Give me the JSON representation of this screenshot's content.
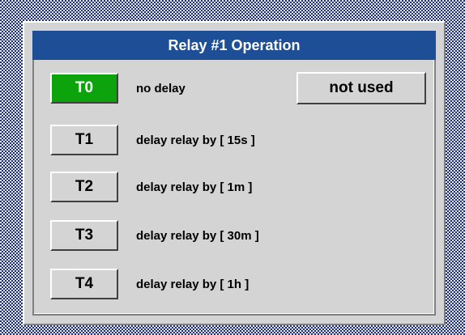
{
  "dialog": {
    "title": "Relay #1 Operation",
    "not_used_label": "not used",
    "rows": [
      {
        "button": "T0",
        "label": "no delay",
        "active": true
      },
      {
        "button": "T1",
        "label": "delay relay by [ 15s ]",
        "active": false
      },
      {
        "button": "T2",
        "label": "delay relay by [ 1m ]",
        "active": false
      },
      {
        "button": "T3",
        "label": "delay relay by [ 30m ]",
        "active": false
      },
      {
        "button": "T4",
        "label": "delay relay by [ 1h ]",
        "active": false
      }
    ]
  },
  "colors": {
    "title_bar": "#1e4f96",
    "active_button": "#0ca30c",
    "panel": "#d4d4d4"
  }
}
